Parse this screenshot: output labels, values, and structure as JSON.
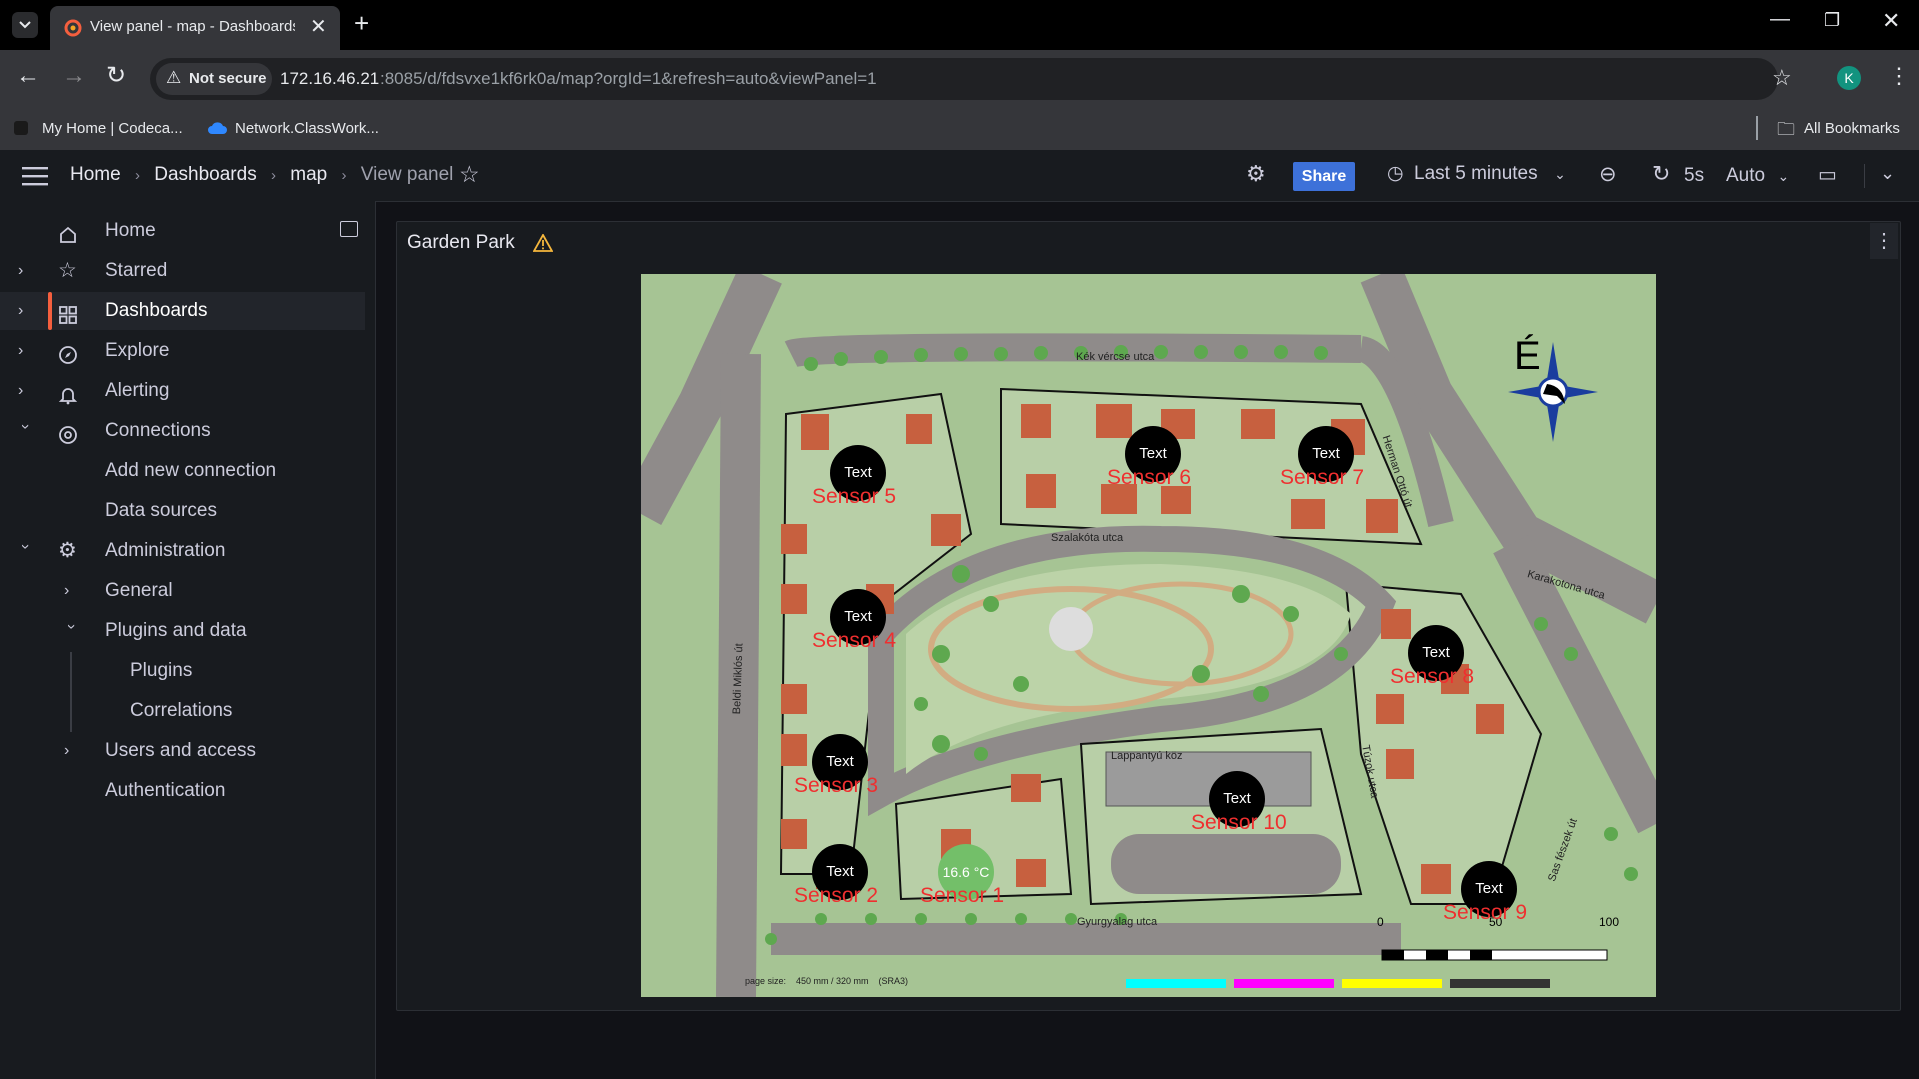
{
  "browser": {
    "tab_title": "View panel - map - Dashboards",
    "security_label": "Not secure",
    "url_host": "172.16.46.21",
    "url_rest": ":8085/d/fdsvxe1kf6rk0a/map?orgId=1&refresh=auto&viewPanel=1",
    "bookmarks": [
      "My Home | Codeca...",
      "Network.ClassWork..."
    ],
    "all_bookmarks": "All Bookmarks",
    "profile_initial": "K"
  },
  "header": {
    "breadcrumbs": [
      "Home",
      "Dashboards",
      "map",
      "View panel"
    ],
    "share_label": "Share",
    "time_range": "Last 5 minutes",
    "refresh_interval": "5s",
    "auto_label": "Auto"
  },
  "sidebar": {
    "items": [
      {
        "label": "Home"
      },
      {
        "label": "Starred"
      },
      {
        "label": "Dashboards"
      },
      {
        "label": "Explore"
      },
      {
        "label": "Alerting"
      },
      {
        "label": "Connections"
      },
      {
        "label": "Add new connection"
      },
      {
        "label": "Data sources"
      },
      {
        "label": "Administration"
      },
      {
        "label": "General"
      },
      {
        "label": "Plugins and data"
      },
      {
        "label": "Plugins"
      },
      {
        "label": "Correlations"
      },
      {
        "label": "Users and access"
      },
      {
        "label": "Authentication"
      }
    ]
  },
  "panel": {
    "title": "Garden Park"
  },
  "map": {
    "streets": [
      "Kék vércse utca",
      "Herman Ottó út",
      "Szalakóta utca",
      "Karakotona utca",
      "Beldi Miklós út",
      "Lappantyú köz",
      "Túzok utca",
      "Sas fészek út",
      "Gyurgyalag utca"
    ],
    "compass_letter": "É",
    "scale_labels": [
      "0",
      "50",
      "100"
    ],
    "page_size_text": "page size:    450 mm / 320 mm    (SRA3)",
    "sensors": [
      {
        "circle": "16.6 °C",
        "label": "Sensor 1",
        "color": "#73bf69"
      },
      {
        "circle": "Text",
        "label": "Sensor 2",
        "color": "#000000"
      },
      {
        "circle": "Text",
        "label": "Sensor 3",
        "color": "#000000"
      },
      {
        "circle": "Text",
        "label": "Sensor 4",
        "color": "#000000"
      },
      {
        "circle": "Text",
        "label": "Sensor 5",
        "color": "#000000"
      },
      {
        "circle": "Text",
        "label": "Sensor 6",
        "color": "#000000"
      },
      {
        "circle": "Text",
        "label": "Sensor 7",
        "color": "#000000"
      },
      {
        "circle": "Text",
        "label": "Sensor 8",
        "color": "#000000"
      },
      {
        "circle": "Text",
        "label": "Sensor 9",
        "color": "#000000"
      },
      {
        "circle": "Text",
        "label": "Sensor 10",
        "color": "#000000"
      }
    ]
  },
  "colors": {
    "accent": "#f55f3e",
    "share": "#3d71d9",
    "sensor_label": "#ef2f2f",
    "warning": "#f5b73d"
  }
}
